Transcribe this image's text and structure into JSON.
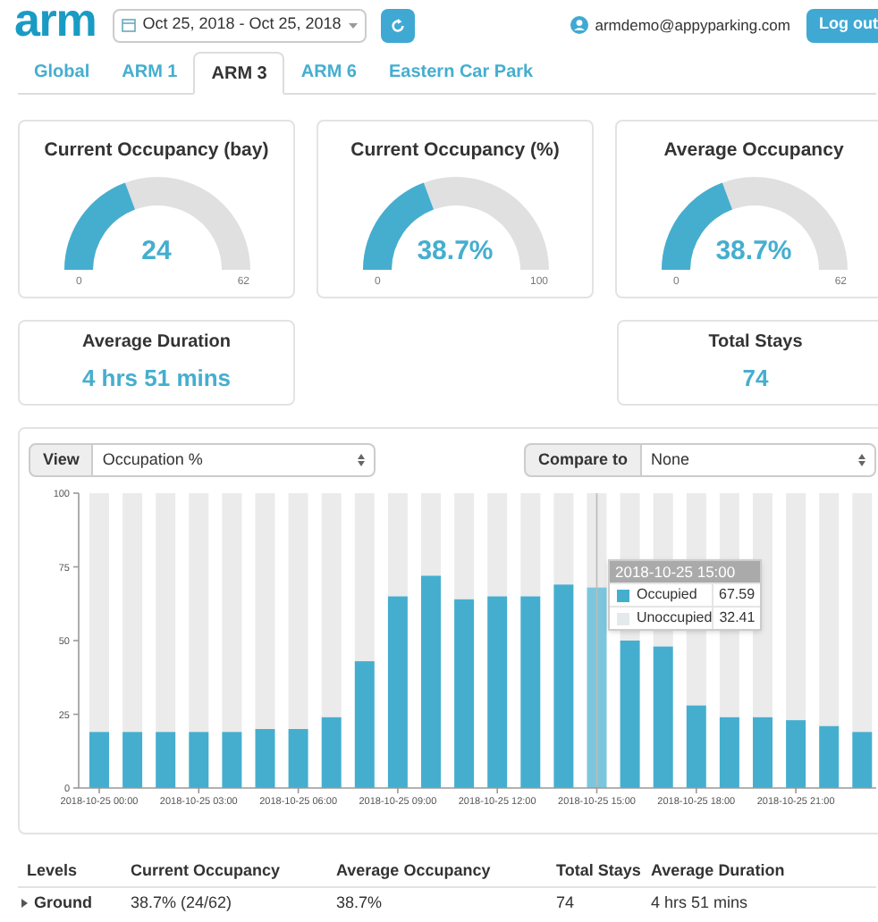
{
  "header": {
    "logo": "arm",
    "date_range": "Oct 25, 2018 - Oct 25, 2018",
    "user_email": "armdemo@appyparking.com",
    "logout_label": "Log out"
  },
  "tabs": [
    {
      "label": "Global",
      "selected": false
    },
    {
      "label": "ARM 1",
      "selected": false
    },
    {
      "label": "ARM 3",
      "selected": true
    },
    {
      "label": "ARM 6",
      "selected": false
    },
    {
      "label": "Eastern Car Park",
      "selected": false
    }
  ],
  "gauges": [
    {
      "title": "Current Occupancy (bay)",
      "value": "24",
      "min": "0",
      "max": "62"
    },
    {
      "title": "Current Occupancy (%)",
      "value": "38.7%",
      "min": "0",
      "max": "100"
    },
    {
      "title": "Average Occupancy",
      "value": "38.7%",
      "min": "0",
      "max": "62"
    }
  ],
  "stats": [
    {
      "title": "Average Duration",
      "value": "4 hrs 51 mins"
    },
    {
      "title": "Total Stays",
      "value": "74"
    }
  ],
  "chart_panel": {
    "view_label": "View",
    "view_value": "Occupation %",
    "compare_label": "Compare to",
    "compare_value": "None",
    "chart_data": {
      "type": "bar",
      "stacked": true,
      "categories": [
        "2018-10-25 00:00",
        null,
        null,
        "2018-10-25 03:00",
        null,
        null,
        "2018-10-25 06:00",
        null,
        null,
        "2018-10-25 09:00",
        null,
        null,
        "2018-10-25 12:00",
        null,
        null,
        "2018-10-25 15:00",
        null,
        null,
        "2018-10-25 18:00",
        null,
        null,
        "2018-10-25 21:00",
        null,
        null
      ],
      "series": [
        {
          "name": "Occupied",
          "color": "#45aecf",
          "values": [
            19,
            19,
            19,
            19,
            19,
            20,
            20,
            24,
            43,
            65,
            72,
            64,
            65,
            65,
            69,
            68,
            50,
            48,
            28,
            24,
            24,
            23,
            21,
            19
          ]
        },
        {
          "name": "Unoccupied",
          "color": "#ebebeb",
          "values": [
            81,
            81,
            81,
            81,
            81,
            80,
            80,
            76,
            57,
            35,
            28,
            36,
            35,
            35,
            31,
            32,
            50,
            52,
            72,
            76,
            76,
            77,
            79,
            81
          ]
        }
      ],
      "ylim": [
        0,
        100
      ],
      "yticks": [
        0,
        25,
        50,
        75,
        100
      ]
    },
    "tooltip": {
      "title": "2018-10-25 15:00",
      "rows": [
        {
          "value": "67.59",
          "color": "#45aecf"
        },
        {
          "value": "32.41",
          "color": "#e4e9ec"
        }
      ]
    }
  },
  "table": {
    "columns": [
      "Levels",
      "Current Occupancy",
      "Average Occupancy",
      "Total Stays",
      "Average Duration"
    ],
    "rows": [
      {
        "expanded": false,
        "cells": [
          "Ground",
          "38.7% (24/62)",
          "38.7%",
          "74",
          "4 hrs 51 mins"
        ]
      }
    ]
  }
}
